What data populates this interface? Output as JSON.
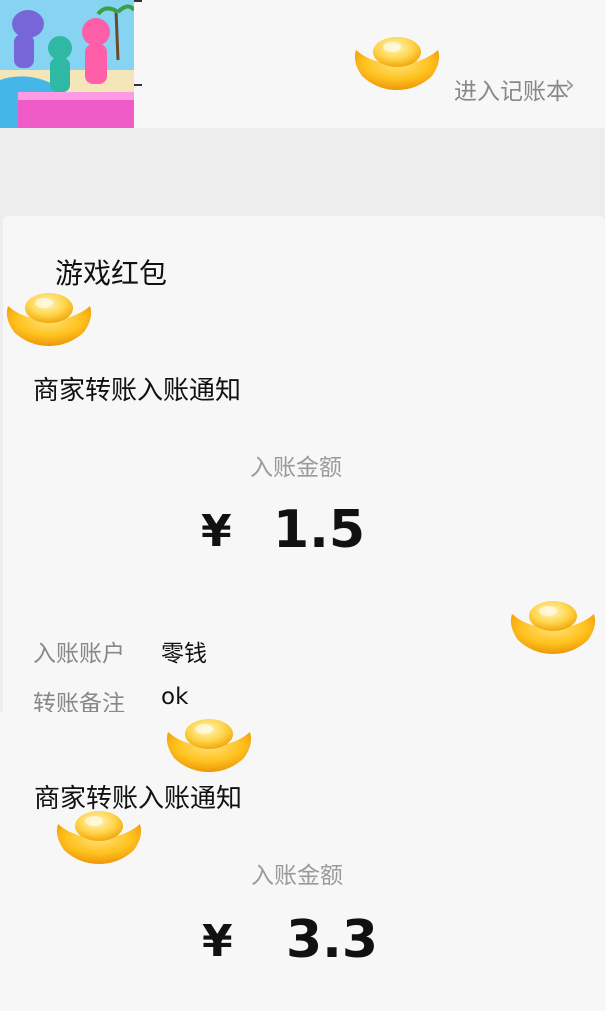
{
  "top_card": {
    "link_label": "进入记账本",
    "chevron": "chevron-right-icon"
  },
  "main_card": {
    "game_title": "游戏红包",
    "notice_title": "商家转账入账通知",
    "amount_label": "入账金额",
    "currency": "¥",
    "amount": "1.5",
    "account_label": "入账账户",
    "account_value": "零钱",
    "remark_label": "转账备注",
    "remark_value": "ok"
  },
  "second_card": {
    "notice_title": "商家转账入账通知",
    "amount_label": "入账金额",
    "currency": "¥",
    "amount": "3.3"
  },
  "colors": {
    "page_bg": "#ededed",
    "card_bg": "#f7f7f7",
    "gold": "#f7b21a",
    "muted_text": "#9a9a9a"
  },
  "icons": [
    "gold-ingot-icon",
    "chevron-right-icon",
    "game-thumbnail"
  ]
}
